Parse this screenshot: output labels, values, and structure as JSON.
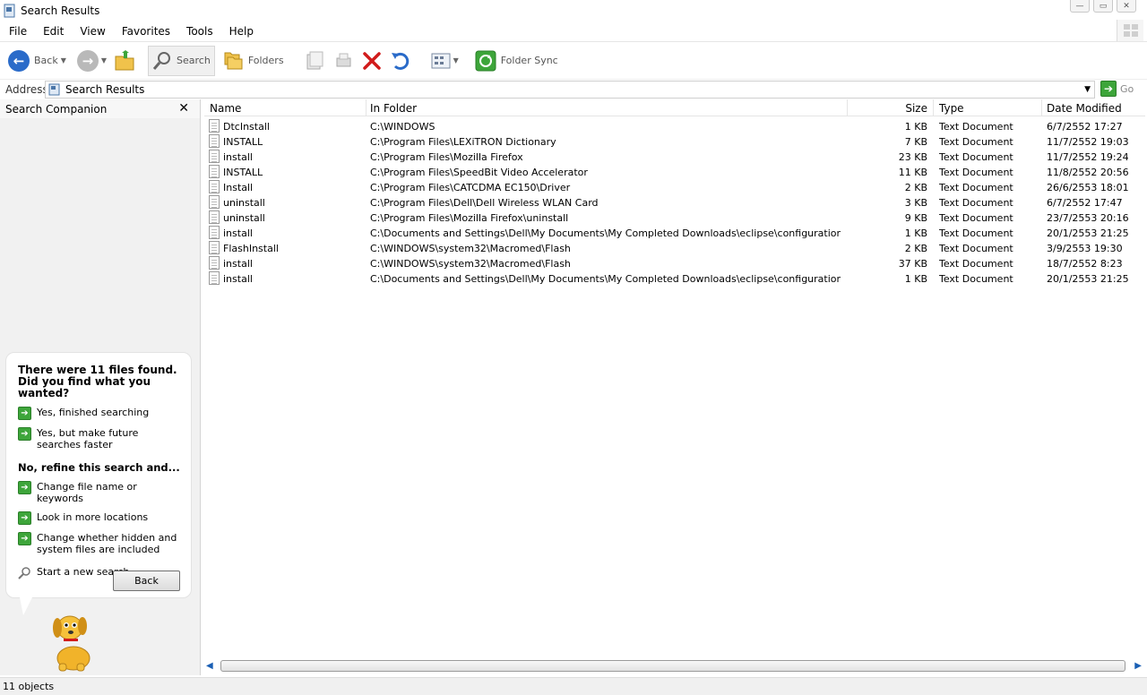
{
  "window": {
    "title": "Search Results"
  },
  "menu": [
    "File",
    "Edit",
    "View",
    "Favorites",
    "Tools",
    "Help"
  ],
  "toolbar": {
    "back": "Back",
    "search": "Search",
    "folders": "Folders",
    "folder_sync": "Folder Sync"
  },
  "address": {
    "label": "Address",
    "value": "Search Results",
    "go": "Go"
  },
  "companion": {
    "title": "Search Companion",
    "found_text": "There were 11 files found. Did you find what you wanted?",
    "yes_finished": "Yes, finished searching",
    "yes_faster": "Yes, but make future searches faster",
    "refine": "No, refine this search and...",
    "change_name": "Change file name or keywords",
    "more_locations": "Look in more locations",
    "hidden_files": "Change whether hidden and system files are included",
    "new_search": "Start a new search",
    "back_button": "Back"
  },
  "columns": {
    "name": "Name",
    "folder": "In Folder",
    "size": "Size",
    "type": "Type",
    "date": "Date Modified"
  },
  "files": [
    {
      "name": "DtcInstall",
      "folder": "C:\\WINDOWS",
      "size": "1 KB",
      "type": "Text Document",
      "date": "6/7/2552 17:27"
    },
    {
      "name": "INSTALL",
      "folder": "C:\\Program Files\\LEXiTRON Dictionary",
      "size": "7 KB",
      "type": "Text Document",
      "date": "11/7/2552 19:03"
    },
    {
      "name": "install",
      "folder": "C:\\Program Files\\Mozilla Firefox",
      "size": "23 KB",
      "type": "Text Document",
      "date": "11/7/2552 19:24"
    },
    {
      "name": "INSTALL",
      "folder": "C:\\Program Files\\SpeedBit Video Accelerator",
      "size": "11 KB",
      "type": "Text Document",
      "date": "11/8/2552 20:56"
    },
    {
      "name": "Install",
      "folder": "C:\\Program Files\\CATCDMA EC150\\Driver",
      "size": "2 KB",
      "type": "Text Document",
      "date": "26/6/2553 18:01"
    },
    {
      "name": "uninstall",
      "folder": "C:\\Program Files\\Dell\\Dell Wireless WLAN Card",
      "size": "3 KB",
      "type": "Text Document",
      "date": "6/7/2552 17:47"
    },
    {
      "name": "uninstall",
      "folder": "C:\\Program Files\\Mozilla Firefox\\uninstall",
      "size": "9 KB",
      "type": "Text Document",
      "date": "23/7/2553 20:16"
    },
    {
      "name": "install",
      "folder": "C:\\Documents and Settings\\Dell\\My Documents\\My Completed Downloads\\eclipse\\configuration\\or...",
      "size": "1 KB",
      "type": "Text Document",
      "date": "20/1/2553 21:25"
    },
    {
      "name": "FlashInstall",
      "folder": "C:\\WINDOWS\\system32\\Macromed\\Flash",
      "size": "2 KB",
      "type": "Text Document",
      "date": "3/9/2553 19:30"
    },
    {
      "name": "install",
      "folder": "C:\\WINDOWS\\system32\\Macromed\\Flash",
      "size": "37 KB",
      "type": "Text Document",
      "date": "18/7/2552 8:23"
    },
    {
      "name": "install",
      "folder": "C:\\Documents and Settings\\Dell\\My Documents\\My Completed Downloads\\eclipse\\configuration\\or...",
      "size": "1 KB",
      "type": "Text Document",
      "date": "20/1/2553 21:25"
    }
  ],
  "status": {
    "count": "11 objects"
  },
  "colors": {
    "accent_green": "#3da53a",
    "delete_red": "#d11b1b",
    "nav_blue": "#2a6bc9"
  }
}
